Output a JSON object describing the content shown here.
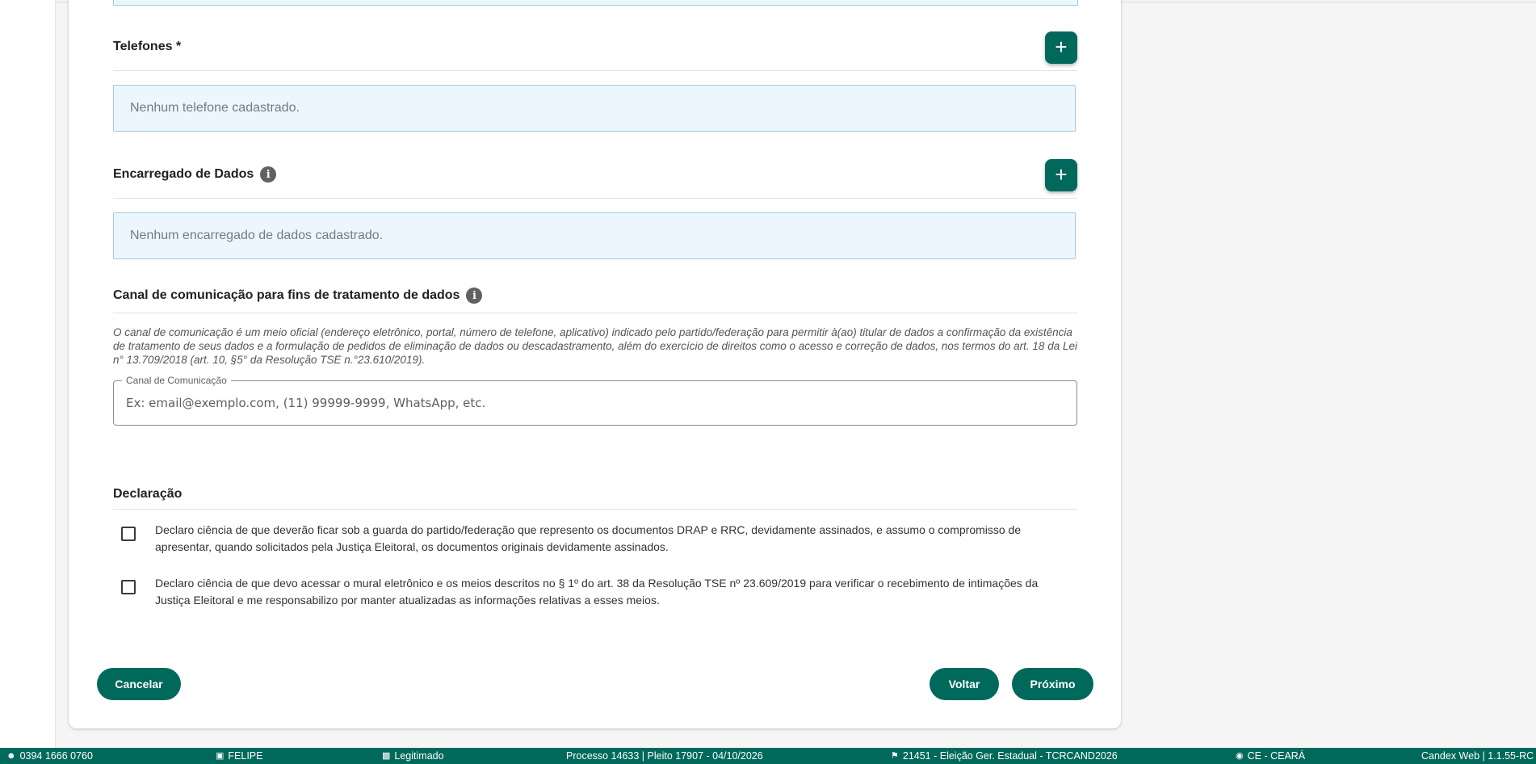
{
  "phones": {
    "title": "Telefones *",
    "empty_text": "Nenhum telefone cadastrado.",
    "add_icon": "plus-icon"
  },
  "data_officer": {
    "title": "Encarregado de Dados",
    "info_icon": "info-icon",
    "empty_text": "Nenhum encarregado de dados cadastrado.",
    "add_icon": "plus-icon"
  },
  "channel": {
    "title": "Canal de comunicação para fins de tratamento de dados",
    "description": "O canal de comunicação é um meio oficial (endereço eletrônico, portal, número de telefone, aplicativo) indicado pelo partido/federação para permitir à(ao) titular de dados a confirmação da existência de tratamento de seus dados e a formulação de pedidos de eliminação de dados ou descadastramento, além do exercício de direitos como o acesso e correção de dados, nos termos do art. 18 da Lei n° 13.709/2018 (art. 10, §5° da Resolução TSE n.°23.610/2019).",
    "field_label": "Canal de Comunicação",
    "field_value": "",
    "field_placeholder": "Ex: email@exemplo.com, (11) 99999-9999, WhatsApp, etc."
  },
  "declaration": {
    "title": "Declaração",
    "items": [
      {
        "text": "Declaro ciência de que deverão ficar sob a guarda do partido/federação que represento os documentos DRAP e RRC, devidamente assinados, e assumo o compromisso de apresentar, quando solicitados pela Justiça Eleitoral, os documentos originais devidamente assinados.",
        "checked": false
      },
      {
        "text": "Declaro ciência de que devo acessar o mural eletrônico e os meios descritos no § 1º do art. 38 da Resolução TSE nº 23.609/2019 para verificar o recebimento de intimações da Justiça Eleitoral e me responsabilizo por manter atualizadas as informações relativas a esses meios.",
        "checked": false
      }
    ]
  },
  "actions": {
    "cancel": "Cancelar",
    "back": "Voltar",
    "next": "Próximo"
  },
  "statusbar": {
    "id": "0394 1666 0760",
    "user": "FELIPE",
    "role": "Legitimado",
    "process": "Processo 14633 | Pleito 17907 - 04/10/2026",
    "election": "21451 - Eleição Ger. Estadual - TCRCAND2026",
    "region": "CE - CEARÁ",
    "app_version": "Candex Web | 1.1.55-RC"
  },
  "colors": {
    "primary": "#00695c",
    "empty_box_bg": "#eef6fd",
    "empty_box_border": "#9fcbe6"
  }
}
